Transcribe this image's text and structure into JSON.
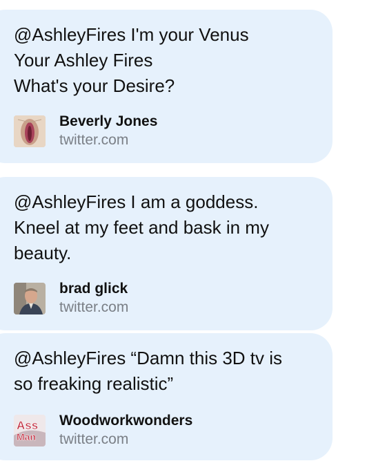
{
  "messages": [
    {
      "text": "@AshleyFires I'm your Venus\nYour Ashley Fires\nWhat's your Desire?",
      "author": "Beverly Jones",
      "domain": "twitter.com",
      "thumbnail_icon": "profile-thumbnail-icon"
    },
    {
      "text": "@AshleyFires I am a goddess.\nKneel at my feet and bask in my\nbeauty.",
      "author": "brad glick",
      "domain": "twitter.com",
      "thumbnail_icon": "avatar-photo-icon"
    },
    {
      "text": "@AshleyFires “Damn this 3D tv is\nso freaking realistic”",
      "author": "Woodworkwonders",
      "domain": "twitter.com",
      "thumbnail_icon": "ass-man-logo-icon",
      "thumbnail_text": [
        "Ass",
        "Man"
      ]
    }
  ],
  "colors": {
    "bubble_background": "#e6f1fc",
    "text": "#111111",
    "domain_text": "#7a7f86"
  }
}
